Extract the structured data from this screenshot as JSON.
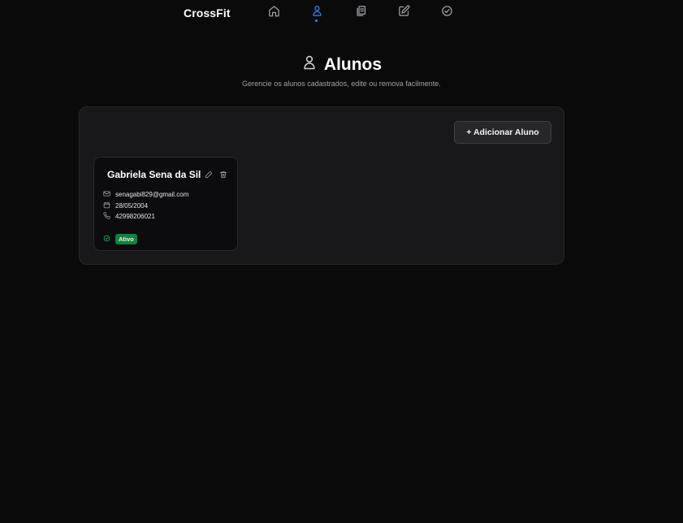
{
  "app": {
    "brand": "CrossFit"
  },
  "nav": {
    "items": [
      {
        "icon": "home-icon",
        "active": false
      },
      {
        "icon": "user-icon",
        "active": true
      },
      {
        "icon": "copy-icon",
        "active": false
      },
      {
        "icon": "edit-icon",
        "active": false
      },
      {
        "icon": "check-circle-icon",
        "active": false
      }
    ],
    "active_color": "#3b82f6"
  },
  "page": {
    "title": "Alunos",
    "subtitle": "Gerencie os alunos cadastrados, edite ou remova facilmente."
  },
  "toolbar": {
    "add_label": "+ Adicionar Aluno"
  },
  "students": [
    {
      "name": "Gabriela Sena da Sil",
      "email": "senagabi829@gmail.com",
      "birthdate": "28/05/2004",
      "phone": "42998206021",
      "status": "Ativo",
      "status_color": "#15803d"
    }
  ]
}
